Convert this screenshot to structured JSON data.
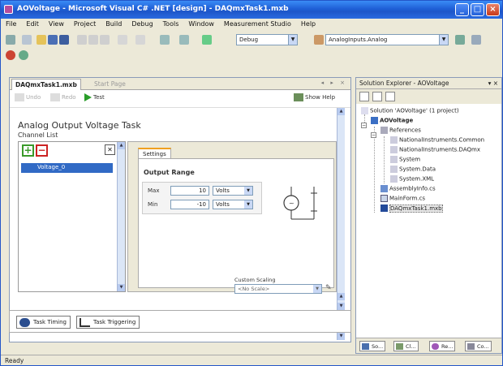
{
  "window": {
    "title": "AOVoltage - Microsoft Visual C# .NET [design] - DAQmxTask1.mxb",
    "controls": [
      "_",
      "□",
      "×"
    ]
  },
  "menubar": [
    "File",
    "Edit",
    "View",
    "Project",
    "Build",
    "Debug",
    "Tools",
    "Window",
    "Measurement Studio",
    "Help"
  ],
  "toolbar": {
    "config_combo": "Debug",
    "find_combo": "AnalogInputs.Analog"
  },
  "document": {
    "tabs": [
      {
        "label": "DAQmxTask1.mxb",
        "active": true
      },
      {
        "label": "Start Page",
        "active": false
      }
    ],
    "tab_controls": "◂ ▸ ×",
    "actions": {
      "undo": "Undo",
      "redo": "Redo",
      "run": "Test",
      "show_help": "Show Help"
    },
    "task_title": "Analog Output Voltage Task",
    "channel_label": "Channel List",
    "channel_items": [
      "Voltage_0"
    ],
    "settings_tab": "Settings",
    "output_range": {
      "title": "Output Range",
      "max_label": "Max",
      "max_value": "10",
      "max_unit": "Volts",
      "min_label": "Min",
      "min_value": "-10",
      "min_unit": "Volts"
    },
    "custom_scaling": {
      "label": "Custom Scaling",
      "value": "<No Scale>"
    },
    "bottom_tabs": [
      {
        "label": "Task Timing"
      },
      {
        "label": "Task Triggering"
      }
    ]
  },
  "solution_explorer": {
    "title": "Solution Explorer - AOVoltage",
    "title_controls": "▾ ×",
    "tree": [
      {
        "label": "Solution 'AOVoltage' (1 project)",
        "level": 0,
        "icon": "solution-icon"
      },
      {
        "label": "AOVoltage",
        "level": 1,
        "icon": "csharp-project-icon",
        "bold": true
      },
      {
        "label": "References",
        "level": 2,
        "icon": "references-icon"
      },
      {
        "label": "NationalInstruments.Common",
        "level": 3,
        "icon": "reference-icon"
      },
      {
        "label": "NationalInstruments.DAQmx",
        "level": 3,
        "icon": "reference-icon"
      },
      {
        "label": "System",
        "level": 3,
        "icon": "reference-icon"
      },
      {
        "label": "System.Data",
        "level": 3,
        "icon": "reference-icon"
      },
      {
        "label": "System.XML",
        "level": 3,
        "icon": "reference-icon"
      },
      {
        "label": "AssemblyInfo.cs",
        "level": 2,
        "icon": "cs-file-icon"
      },
      {
        "label": "MainForm.cs",
        "level": 2,
        "icon": "form-icon"
      },
      {
        "label": "DAQmxTask1.mxb",
        "level": 2,
        "icon": "daqmx-task-icon",
        "selected": true
      }
    ],
    "tabs": [
      "So...",
      "Cl...",
      "Re...",
      "Co..."
    ]
  },
  "status": "Ready",
  "colors": {
    "titlebar": "#1f5fd6",
    "selection": "#316ac5",
    "add": "#3a9a2a",
    "remove": "#cc2222",
    "tab_highlight": "#f0a020"
  }
}
